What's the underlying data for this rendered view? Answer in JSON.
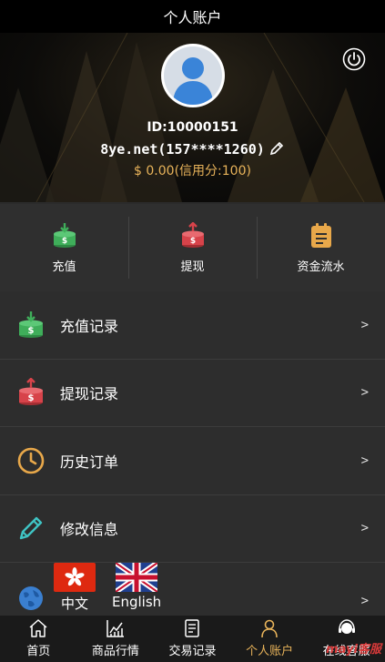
{
  "header": {
    "title": "个人账户"
  },
  "profile": {
    "id": "ID:10000151",
    "account": "8ye.net(157****1260)",
    "balance": "$ 0.00(信用分:100)"
  },
  "quick_actions": [
    {
      "label": "充值",
      "icon": "deposit-icon"
    },
    {
      "label": "提现",
      "icon": "withdraw-icon"
    },
    {
      "label": "资金流水",
      "icon": "ledger-icon"
    }
  ],
  "menu": [
    {
      "label": "充值记录",
      "icon": "deposit-record-icon",
      "arrow": ">"
    },
    {
      "label": "提现记录",
      "icon": "withdraw-record-icon",
      "arrow": ">"
    },
    {
      "label": "历史订单",
      "icon": "clock-icon",
      "arrow": ">"
    },
    {
      "label": "修改信息",
      "icon": "pencil-icon",
      "arrow": ">"
    }
  ],
  "language": {
    "arrow": ">",
    "options": [
      {
        "label": "中文",
        "icon": "hong-kong-flag-icon"
      },
      {
        "label": "English",
        "icon": "uk-flag-icon"
      }
    ]
  },
  "tabs": [
    {
      "label": "首页",
      "icon": "home-icon"
    },
    {
      "label": "商品行情",
      "icon": "chart-icon"
    },
    {
      "label": "交易记录",
      "icon": "document-icon"
    },
    {
      "label": "个人账户",
      "icon": "user-icon",
      "active": true
    },
    {
      "label": "在线客服",
      "icon": "headset-icon"
    }
  ],
  "watermark": "mayi客服",
  "colors": {
    "accent": "#e8b35a",
    "green": "#3fae5a",
    "red": "#d7434a",
    "orange": "#e8a84a",
    "teal": "#3fc4c4",
    "blue": "#3a7fd0"
  }
}
